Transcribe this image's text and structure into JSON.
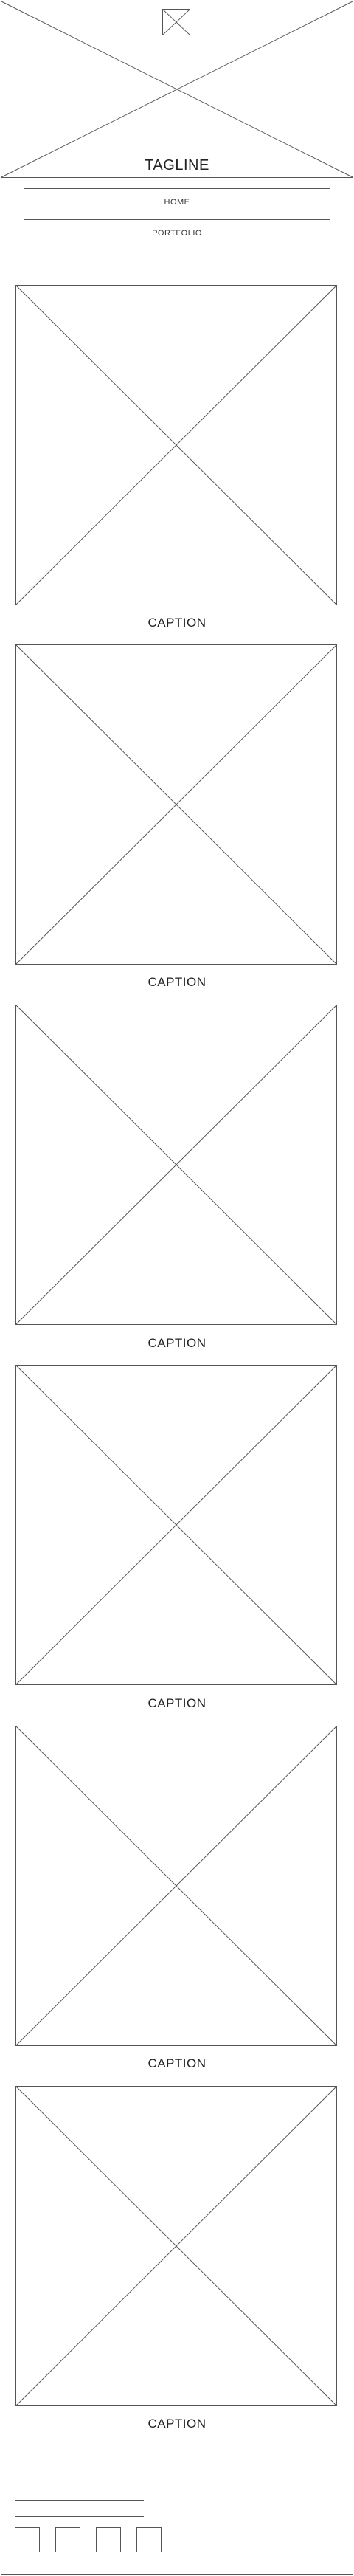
{
  "header": {
    "logo_icon": "image-placeholder-icon",
    "banner_icon": "image-placeholder-icon",
    "tagline": "TAGLINE"
  },
  "nav": {
    "items": [
      {
        "label": "HOME"
      },
      {
        "label": "PORTFOLIO"
      }
    ]
  },
  "gallery": {
    "items": [
      {
        "caption": "CAPTION",
        "icon": "image-placeholder-icon"
      },
      {
        "caption": "CAPTION",
        "icon": "image-placeholder-icon"
      },
      {
        "caption": "CAPTION",
        "icon": "image-placeholder-icon"
      },
      {
        "caption": "CAPTION",
        "icon": "image-placeholder-icon"
      },
      {
        "caption": "CAPTION",
        "icon": "image-placeholder-icon"
      },
      {
        "caption": "CAPTION",
        "icon": "image-placeholder-icon"
      }
    ]
  },
  "footer": {
    "text_lines": 3,
    "social_icons": [
      "social-icon",
      "social-icon",
      "social-icon",
      "social-icon"
    ]
  }
}
